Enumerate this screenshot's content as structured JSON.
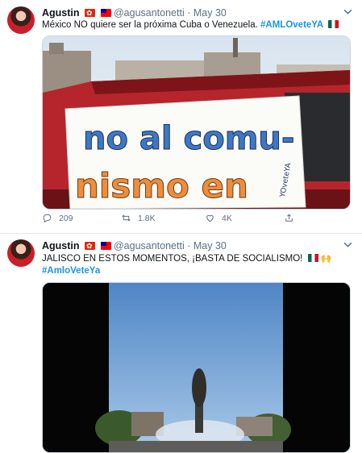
{
  "tweets": [
    {
      "display_name": "Agustin",
      "handle": "@agusantonetti",
      "separator": "·",
      "date": "May 30",
      "text": "México NO quiere ser la próxima Cuba o Venezuela. ",
      "hashtag": "#AMLOveteYA",
      "image_sign_lines": [
        "no al comu-",
        "nismo en"
      ],
      "image_signature": "YOveteYA",
      "stats": {
        "replies": "209",
        "retweets": "1.8K",
        "likes": "4K"
      }
    },
    {
      "display_name": "Agustin",
      "handle": "@agusantonetti",
      "separator": "·",
      "date": "May 30",
      "text": "JALISCO EN ESTOS MOMENTOS, ¡BASTA DE SOCIALISMO! ",
      "hashtag": "#AmloVeteYa"
    }
  ],
  "icons": {
    "avatar": "user-avatar",
    "flags": [
      "hong-kong-flag-icon",
      "taiwan-flag-icon",
      "mexico-flag-icon"
    ],
    "caret": "chevron-down-icon",
    "reply": "reply-icon",
    "retweet": "retweet-icon",
    "like": "heart-icon",
    "share": "share-icon"
  },
  "colors": {
    "link": "#1b95e0",
    "muted": "#5b7083",
    "divider": "#e1e8ed"
  }
}
